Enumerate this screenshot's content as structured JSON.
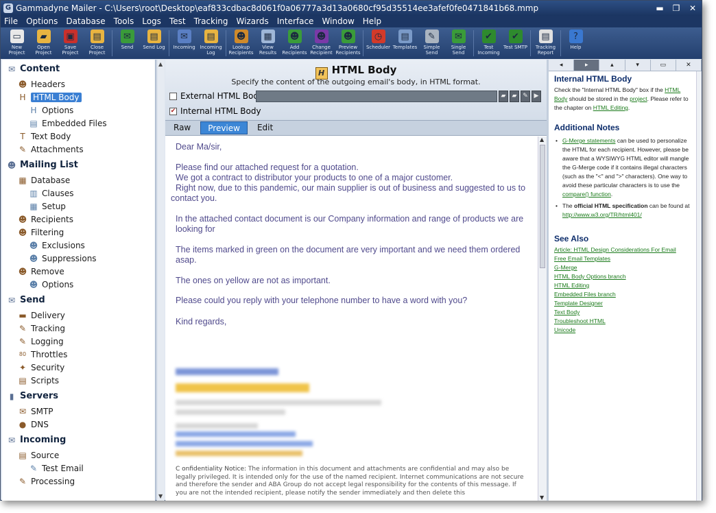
{
  "window": {
    "title": "Gammadyne Mailer - C:\\Users\\root\\Desktop\\eaf833cdbac8d061f0a06777a3d13a0680cf95d35514ee3afef0fe0471841b68.mmp",
    "controls": [
      "minimize",
      "restore",
      "close"
    ]
  },
  "menu": [
    "File",
    "Options",
    "Database",
    "Tools",
    "Logs",
    "Test",
    "Tracking",
    "Wizards",
    "Interface",
    "Window",
    "Help"
  ],
  "toolbar": [
    {
      "label": "New Project",
      "icon": "new-project-icon",
      "glyph": "▭",
      "color": "#e8e8e8"
    },
    {
      "label": "Open Project",
      "icon": "open-project-icon",
      "glyph": "▰",
      "color": "#e8b441"
    },
    {
      "label": "Save Project",
      "icon": "save-project-icon",
      "glyph": "▣",
      "color": "#c9302c"
    },
    {
      "label": "Close Project",
      "icon": "close-project-icon",
      "glyph": "▤",
      "color": "#e8b441"
    },
    {
      "label": "Send",
      "icon": "send-icon",
      "glyph": "✉",
      "color": "#3a9b3a"
    },
    {
      "label": "Send Log",
      "icon": "send-log-icon",
      "glyph": "▤",
      "color": "#e8b441"
    },
    {
      "label": "Incoming",
      "icon": "incoming-icon",
      "glyph": "✉",
      "color": "#5a7fc4"
    },
    {
      "label": "Incoming Log",
      "icon": "incoming-log-icon",
      "glyph": "▤",
      "color": "#e8b441"
    },
    {
      "label": "Lookup Recipients",
      "icon": "lookup-recipients-icon",
      "glyph": "☻",
      "color": "#d08a2a"
    },
    {
      "label": "View Results",
      "icon": "view-results-icon",
      "glyph": "▦",
      "color": "#9fb7d8"
    },
    {
      "label": "Add Recipients",
      "icon": "add-recipients-icon",
      "glyph": "☻",
      "color": "#3a9b3a"
    },
    {
      "label": "Change Recipient",
      "icon": "change-recipient-icon",
      "glyph": "☻",
      "color": "#7a3aa8"
    },
    {
      "label": "Preview Recipients",
      "icon": "preview-recipients-icon",
      "glyph": "☻",
      "color": "#3a9b3a"
    },
    {
      "label": "Scheduler",
      "icon": "scheduler-icon",
      "glyph": "◷",
      "color": "#d23a2a"
    },
    {
      "label": "Templates",
      "icon": "templates-icon",
      "glyph": "▤",
      "color": "#7a9ac8"
    },
    {
      "label": "Simple Send",
      "icon": "simple-send-icon",
      "glyph": "✎",
      "color": "#aab4c0"
    },
    {
      "label": "Single Send",
      "icon": "single-send-icon",
      "glyph": "✉",
      "color": "#3a9b3a"
    },
    {
      "label": "Test Incoming",
      "icon": "test-incoming-icon",
      "glyph": "✔",
      "color": "#2e8a2e"
    },
    {
      "label": "Test SMTP",
      "icon": "test-smtp-icon",
      "glyph": "✔",
      "color": "#2e8a2e"
    },
    {
      "label": "Tracking Report",
      "icon": "tracking-report-icon",
      "glyph": "▤",
      "color": "#e0e0e0"
    },
    {
      "label": "Help",
      "icon": "help-icon",
      "glyph": "?",
      "color": "#3a78d0"
    }
  ],
  "tree": [
    {
      "label": "Content",
      "icon": "content-icon",
      "glyph": "✉",
      "level": 0,
      "header": true
    },
    {
      "label": "Headers",
      "icon": "headers-icon",
      "glyph": "☻",
      "level": 1
    },
    {
      "label": "HTML Body",
      "icon": "html-body-icon",
      "glyph": "H",
      "level": 1,
      "selected": true
    },
    {
      "label": "Options",
      "icon": "options-icon",
      "glyph": "H",
      "level": 2
    },
    {
      "label": "Embedded Files",
      "icon": "embedded-files-icon",
      "glyph": "▤",
      "level": 2
    },
    {
      "label": "Text Body",
      "icon": "text-body-icon",
      "glyph": "T",
      "level": 1
    },
    {
      "label": "Attachments",
      "icon": "attachments-icon",
      "glyph": "✎",
      "level": 1
    },
    {
      "label": "Mailing List",
      "icon": "mailing-list-icon",
      "glyph": "☻",
      "level": 0,
      "header": true
    },
    {
      "label": "Database",
      "icon": "database-icon",
      "glyph": "▦",
      "level": 1
    },
    {
      "label": "Clauses",
      "icon": "clauses-icon",
      "glyph": "▥",
      "level": 2
    },
    {
      "label": "Setup",
      "icon": "setup-icon",
      "glyph": "▦",
      "level": 2
    },
    {
      "label": "Recipients",
      "icon": "recipients-icon",
      "glyph": "☻",
      "level": 1
    },
    {
      "label": "Filtering",
      "icon": "filtering-icon",
      "glyph": "☻",
      "level": 1
    },
    {
      "label": "Exclusions",
      "icon": "exclusions-icon",
      "glyph": "☻",
      "level": 2
    },
    {
      "label": "Suppressions",
      "icon": "suppressions-icon",
      "glyph": "☻",
      "level": 2
    },
    {
      "label": "Remove",
      "icon": "remove-icon",
      "glyph": "☻",
      "level": 1
    },
    {
      "label": "Options",
      "icon": "remove-options-icon",
      "glyph": "☻",
      "level": 2
    },
    {
      "label": "Send",
      "icon": "send-section-icon",
      "glyph": "✉",
      "level": 0,
      "header": true
    },
    {
      "label": "Delivery",
      "icon": "delivery-icon",
      "glyph": "▬",
      "level": 1
    },
    {
      "label": "Tracking",
      "icon": "tracking-icon",
      "glyph": "✎",
      "level": 1
    },
    {
      "label": "Logging",
      "icon": "logging-icon",
      "glyph": "✎",
      "level": 1
    },
    {
      "label": "Throttles",
      "icon": "throttles-icon",
      "glyph": "80",
      "level": 1
    },
    {
      "label": "Security",
      "icon": "security-icon",
      "glyph": "✦",
      "level": 1
    },
    {
      "label": "Scripts",
      "icon": "scripts-icon",
      "glyph": "▤",
      "level": 1
    },
    {
      "label": "Servers",
      "icon": "servers-icon",
      "glyph": "▮",
      "level": 0,
      "header": true
    },
    {
      "label": "SMTP",
      "icon": "smtp-icon",
      "glyph": "✉",
      "level": 1
    },
    {
      "label": "DNS",
      "icon": "dns-icon",
      "glyph": "●",
      "level": 1
    },
    {
      "label": "Incoming",
      "icon": "incoming-section-icon",
      "glyph": "✉",
      "level": 0,
      "header": true
    },
    {
      "label": "Source",
      "icon": "source-icon",
      "glyph": "▤",
      "level": 1
    },
    {
      "label": "Test Email",
      "icon": "test-email-icon",
      "glyph": "✎",
      "level": 2
    },
    {
      "label": "Processing",
      "icon": "processing-icon",
      "glyph": "✎",
      "level": 1
    }
  ],
  "panel": {
    "title": "HTML Body",
    "subtitle": "Specify the content of the outgoing email's body, in HTML format.",
    "external_label": "External HTML Body:",
    "external_checked": false,
    "internal_label": "Internal HTML Body",
    "internal_checked": true,
    "tabs": [
      "Raw",
      "Preview",
      "Edit"
    ],
    "active_tab": "Preview"
  },
  "email": {
    "greeting": "Dear Ma/sir,",
    "p1": "Please find our attached request for a quotation.",
    "p2": "We got a contract to distributor your products to one of a major customer.",
    "p3": "Right now, due to this pandemic, our main supplier is out of business and suggested to us to contact you.",
    "p4": "In the attached contact document is our Company information and range of products we are looking for",
    "p5": "The items marked in green on the document are very important and we need them ordered asap.",
    "p6": "The ones on yellow are not as important.",
    "p7": "Please could you reply with your telephone number to have a word with you?",
    "closing": "Kind regards,",
    "confidentiality_label": "C onfidentiality Notice:",
    "confidentiality_text": "The information in this document and attachments are confidential and may also be legally privileged. It is intended only for the      use  of the named recipient. Internet communications are not secure and therefore the sender and ABA Group do not accept legal responsibility for the contents of this message. If you are not the intended recipient, please notify the sender immediately and then delete this"
  },
  "help": {
    "nav": [
      "◂",
      "▸",
      "▴",
      "▾",
      "▭",
      "✕"
    ],
    "title": "Internal HTML Body",
    "intro_pre": "Check the \"Internal HTML Body\" box if the ",
    "intro_link1": "HTML Body",
    "intro_mid": " should be stored in the ",
    "intro_link2": "project",
    "intro_mid2": ".  Please refer to the chapter on ",
    "intro_link3": "HTML Editing",
    "intro_end": ".",
    "notes_title": "Additional Notes",
    "note1_link": "G-Merge statements",
    "note1_text": " can be used to personalize the HTML for each recipient.  However, please be aware that a WYSIWYG HTML editor will mangle the G-Merge code if it contains illegal characters (such as the \"<\" and \">\" characters).  One way to avoid these particular characters is to use the ",
    "note1_link2": "compare() function",
    "note1_end": ".",
    "note2_pre": "The ",
    "note2_bold": "official HTML specification",
    "note2_mid": " can be found at ",
    "note2_link": "http://www.w3.org/TR/html401/",
    "see_also_title": "See Also",
    "see_also": [
      "Article: HTML Design Considerations For Email",
      "Free Email Templates",
      "G-Merge",
      "HTML Body Options branch",
      "HTML Editing",
      "Embedded Files branch",
      "Template Designer",
      "Text Body",
      "Troubleshoot HTML",
      "Unicode"
    ]
  }
}
